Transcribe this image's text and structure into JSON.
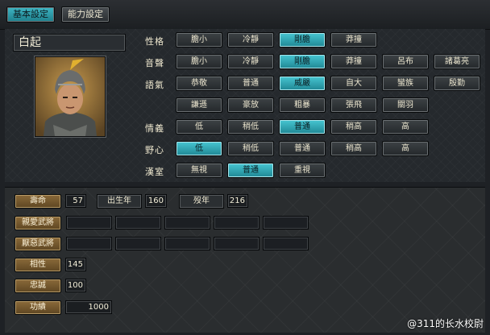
{
  "tabs": [
    {
      "label": "基本設定",
      "active": true
    },
    {
      "label": "能力設定",
      "active": false
    }
  ],
  "character": {
    "name": "白起"
  },
  "traits": [
    {
      "label": "性格",
      "options": [
        "膽小",
        "冷靜",
        "剛膽",
        "莽撞"
      ],
      "selected": 2
    },
    {
      "label": "音聲",
      "options": [
        "膽小",
        "冷靜",
        "剛膽",
        "莽撞",
        "呂布",
        "諸葛亮"
      ],
      "selected": 2
    },
    {
      "label": "語氣",
      "options": [
        "恭敬",
        "普通",
        "威嚴",
        "自大",
        "蠻族",
        "殷勤",
        "謙遜",
        "豪放",
        "粗暴",
        "張飛",
        "關羽"
      ],
      "selected": 2
    },
    {
      "label": "情義",
      "options": [
        "低",
        "稍低",
        "普通",
        "稍高",
        "高"
      ],
      "selected": 2
    },
    {
      "label": "野心",
      "options": [
        "低",
        "稍低",
        "普通",
        "稍高",
        "高"
      ],
      "selected": 0
    },
    {
      "label": "漢室",
      "options": [
        "無視",
        "普通",
        "重視"
      ],
      "selected": 1
    }
  ],
  "stats": {
    "lifespan": {
      "label": "壽命",
      "value": "57"
    },
    "birth_year": {
      "label": "出生年",
      "value": "160"
    },
    "death_year": {
      "label": "歿年",
      "value": "216"
    },
    "favored_generals": {
      "label": "親愛武將"
    },
    "disliked_generals": {
      "label": "厭惡武將"
    },
    "compatibility": {
      "label": "相性",
      "value": "145"
    },
    "loyalty": {
      "label": "忠誠",
      "value": "100"
    },
    "merit": {
      "label": "功績",
      "value": "1000"
    }
  },
  "watermark": "@311的长水校尉",
  "colors": {
    "selected": "#2fa8b6",
    "label_gold": "#7a5c30"
  }
}
